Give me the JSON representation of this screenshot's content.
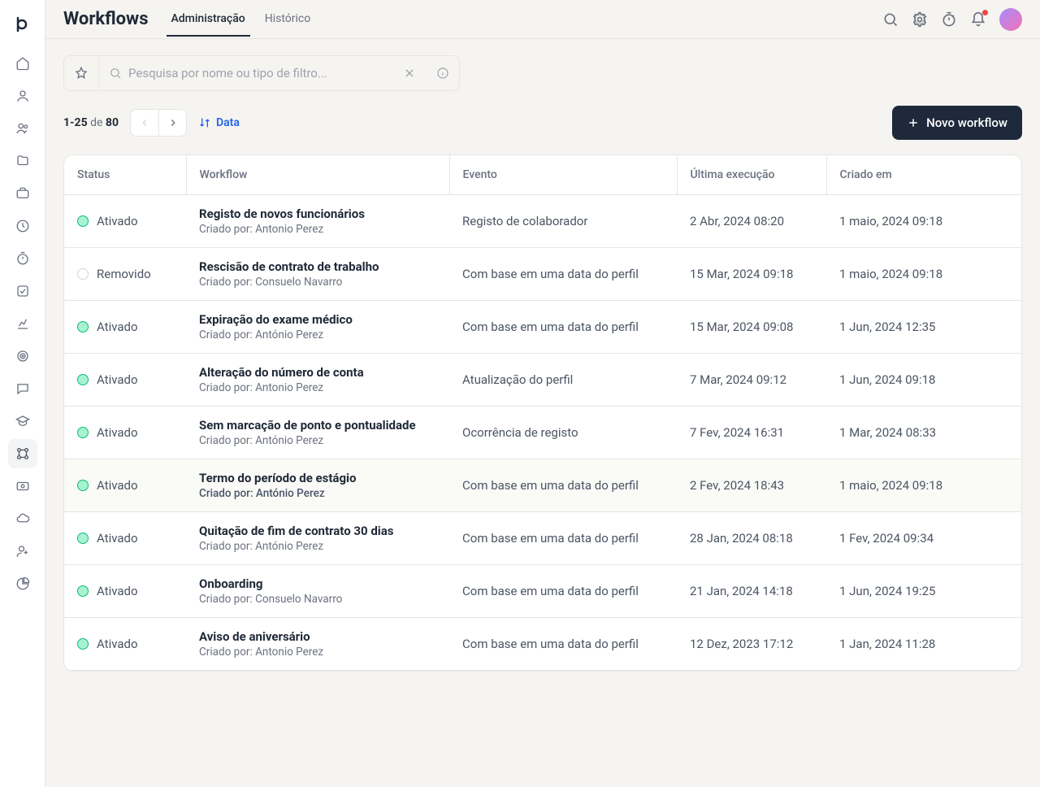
{
  "header": {
    "title": "Workflows",
    "tabs": [
      "Administração",
      "Histórico"
    ],
    "active_tab": 0
  },
  "search": {
    "placeholder": "Pesquisa por nome ou tipo de filtro..."
  },
  "pager": {
    "range": "1-25",
    "of": "de",
    "total": "80"
  },
  "sort": {
    "label": "Data"
  },
  "new_button": "Novo workflow",
  "columns": {
    "status": "Status",
    "workflow": "Workflow",
    "event": "Evento",
    "last_run": "Última execução",
    "created": "Criado em"
  },
  "creator_prefix": "Criado por: ",
  "status_labels": {
    "active": "Ativado",
    "removed": "Removido"
  },
  "rows": [
    {
      "status": "active",
      "name": "Registo de novos funcionários",
      "creator": "Antonio Perez",
      "event": "Registo de colaborador",
      "last_run": "2 Abr, 2024 08:20",
      "created": "1 maio, 2024 09:18"
    },
    {
      "status": "removed",
      "name": "Rescisão de contrato de trabalho",
      "creator": "Consuelo Navarro",
      "event": "Com base em uma data do perfil",
      "last_run": "15 Mar, 2024 09:18",
      "created": "1 maio, 2024 09:18"
    },
    {
      "status": "active",
      "name": "Expiração do exame médico",
      "creator": "António Perez",
      "event": "Com base em uma data do perfil",
      "last_run": "15 Mar, 2024 09:08",
      "created": "1 Jun, 2024 12:35"
    },
    {
      "status": "active",
      "name": "Alteração do número de conta",
      "creator": "Antonio Perez",
      "event": "Atualização do perfil",
      "last_run": "7 Mar, 2024 09:12",
      "created": "1 Jun, 2024 09:18"
    },
    {
      "status": "active",
      "name": "Sem marcação de ponto e pontualidade",
      "creator": "António Perez",
      "event": "Ocorrência de registo",
      "last_run": "7 Fev, 2024 16:31",
      "created": "1 Mar, 2024 08:33"
    },
    {
      "status": "active",
      "name": "Termo do período de estágio",
      "creator": "António Perez",
      "event": "Com base em uma data do perfil",
      "last_run": "2 Fev, 2024 18:43",
      "created": "1 maio, 2024 09:18",
      "hover": true
    },
    {
      "status": "active",
      "name": "Quitação de fim de contrato 30 dias",
      "creator": "António Perez",
      "event": "Com base em uma data do perfil",
      "last_run": "28 Jan, 2024 08:18",
      "created": "1 Fev, 2024 09:34"
    },
    {
      "status": "active",
      "name": "Onboarding",
      "creator": "Consuelo Navarro",
      "event": "Com base em uma data do perfil",
      "last_run": "21 Jan, 2024 14:18",
      "created": "1 Jun, 2024 19:25"
    },
    {
      "status": "active",
      "name": "Aviso de aniversário",
      "creator": "Antonio Perez",
      "event": "Com base em uma data do perfil",
      "last_run": "12 Dez, 2023 17:12",
      "created": "1 Jan, 2024 11:28"
    }
  ]
}
